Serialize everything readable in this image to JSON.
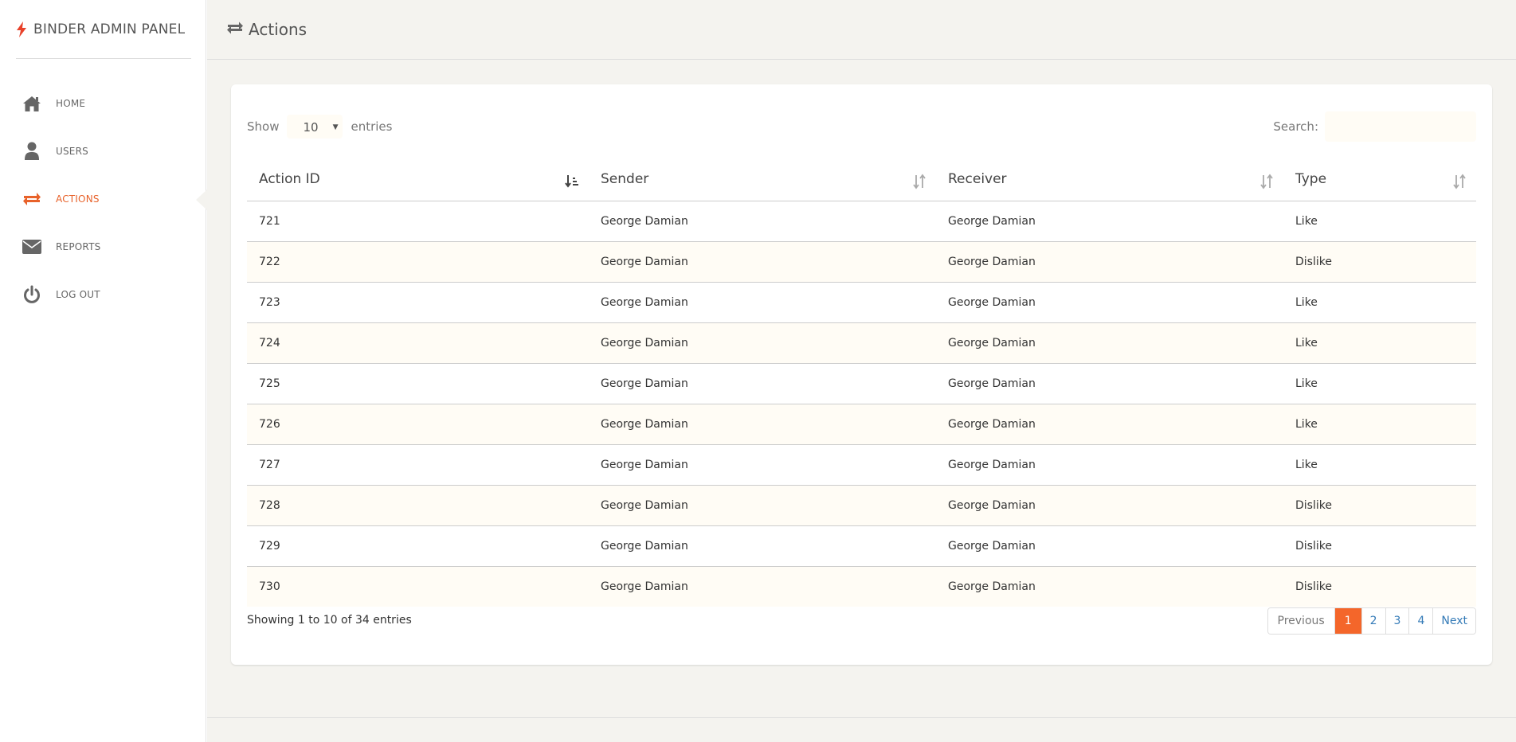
{
  "brand": {
    "title": "BINDER ADMIN PANEL"
  },
  "sidebar": {
    "items": [
      {
        "label": "HOME"
      },
      {
        "label": "USERS"
      },
      {
        "label": "ACTIONS"
      },
      {
        "label": "REPORTS"
      },
      {
        "label": "LOG OUT"
      }
    ],
    "active_index": 2
  },
  "header": {
    "title": "Actions"
  },
  "table_controls": {
    "show_label": "Show",
    "entries_value": "10",
    "entries_label": "entries",
    "search_label": "Search:",
    "search_value": ""
  },
  "table": {
    "columns": [
      "Action ID",
      "Sender",
      "Receiver",
      "Type"
    ],
    "rows": [
      [
        "721",
        "George Damian",
        "George Damian",
        "Like"
      ],
      [
        "722",
        "George Damian",
        "George Damian",
        "Dislike"
      ],
      [
        "723",
        "George Damian",
        "George Damian",
        "Like"
      ],
      [
        "724",
        "George Damian",
        "George Damian",
        "Like"
      ],
      [
        "725",
        "George Damian",
        "George Damian",
        "Like"
      ],
      [
        "726",
        "George Damian",
        "George Damian",
        "Like"
      ],
      [
        "727",
        "George Damian",
        "George Damian",
        "Like"
      ],
      [
        "728",
        "George Damian",
        "George Damian",
        "Dislike"
      ],
      [
        "729",
        "George Damian",
        "George Damian",
        "Dislike"
      ],
      [
        "730",
        "George Damian",
        "George Damian",
        "Dislike"
      ]
    ]
  },
  "info": "Showing 1 to 10 of 34 entries",
  "pagination": {
    "previous": "Previous",
    "pages": [
      "1",
      "2",
      "3",
      "4"
    ],
    "current": "1",
    "next": "Next"
  },
  "colors": {
    "accent": "#f4662a",
    "active_nav": "#e8622a",
    "brand_icon": "#e8422a"
  },
  "icons": {
    "brand": "bolt-icon",
    "nav": [
      "home-icon",
      "user-icon",
      "arrows-exchange-icon",
      "envelope-icon",
      "power-icon"
    ]
  }
}
